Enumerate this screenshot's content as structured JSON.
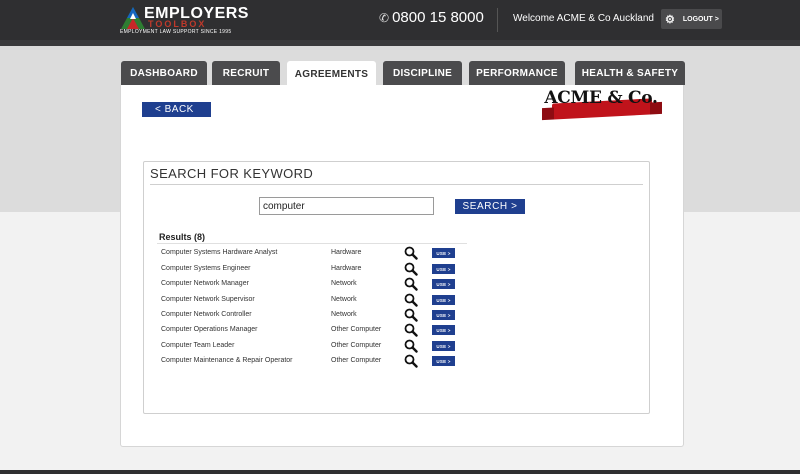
{
  "header": {
    "logo_main": "EMPLOYERS",
    "logo_sub": "TOOLBOX",
    "logo_tagline": "EMPLOYMENT LAW SUPPORT SINCE 1995",
    "phone": "0800 15 8000",
    "welcome": "Welcome ACME & Co Auckland",
    "logout_label": "LOGOUT >"
  },
  "tabs": [
    {
      "label": "DASHBOARD",
      "active": false
    },
    {
      "label": "RECRUIT",
      "active": false
    },
    {
      "label": "AGREEMENTS",
      "active": true
    },
    {
      "label": "DISCIPLINE",
      "active": false
    },
    {
      "label": "PERFORMANCE",
      "active": false
    },
    {
      "label": "HEALTH & SAFETY",
      "active": false
    }
  ],
  "page": {
    "back_label": "< BACK",
    "company_logo_text": "ACME & Co."
  },
  "search": {
    "title": "SEARCH FOR KEYWORD",
    "input_value": "computer",
    "button_label": "SEARCH >"
  },
  "results": {
    "label": "Results (8)",
    "use_label": "USE >",
    "rows": [
      {
        "name": "Computer Systems Hardware Analyst",
        "category": "Hardware"
      },
      {
        "name": "Computer Systems Engineer",
        "category": "Hardware"
      },
      {
        "name": "Computer Network Manager",
        "category": "Network"
      },
      {
        "name": "Computer Network Supervisor",
        "category": "Network"
      },
      {
        "name": "Computer Network Controller",
        "category": "Network"
      },
      {
        "name": "Computer Operations Manager",
        "category": "Other Computer"
      },
      {
        "name": "Computer Team Leader",
        "category": "Other Computer"
      },
      {
        "name": "Computer Maintenance & Repair Operator",
        "category": "Other Computer"
      }
    ]
  },
  "colors": {
    "topbar": "#2f2f31",
    "tab": "#4b4b4d",
    "button_blue": "#1f3f8f",
    "ribbon_red": "#c0131b"
  },
  "icons": {
    "phone": "phone-icon",
    "gear": "gear-icon",
    "magnifier": "search-icon"
  }
}
